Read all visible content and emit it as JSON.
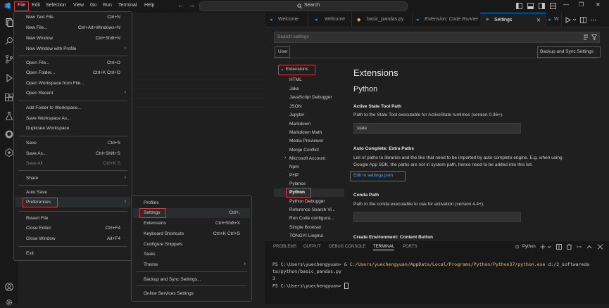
{
  "titlebar": {
    "menu": [
      "File",
      "Edit",
      "Selection",
      "View",
      "Go",
      "Run",
      "Terminal",
      "Help"
    ],
    "search_text": "Search",
    "nav_back": "←",
    "nav_forward": "→",
    "window_controls": [
      "—",
      "❐",
      "✕"
    ]
  },
  "file_menu": {
    "items": [
      {
        "label": "New Text File",
        "key": "Ctrl+N"
      },
      {
        "label": "New File...",
        "key": "Ctrl+Alt+Windows+N"
      },
      {
        "label": "New Window",
        "key": "Ctrl+Shift+N"
      },
      {
        "label": "New Window with Profile",
        "key": "›"
      },
      {
        "label": "Open File...",
        "key": "Ctrl+O"
      },
      {
        "label": "Open Folder...",
        "key": "Ctrl+K Ctrl+O"
      },
      {
        "label": "Open Workspace from File...",
        "key": ""
      },
      {
        "label": "Open Recent",
        "key": "›"
      },
      {
        "label": "Add Folder to Workspace...",
        "key": ""
      },
      {
        "label": "Save Workspace As...",
        "key": ""
      },
      {
        "label": "Duplicate Workspace",
        "key": ""
      },
      {
        "label": "Save",
        "key": "Ctrl+S"
      },
      {
        "label": "Save As...",
        "key": "Ctrl+Shift+S"
      },
      {
        "label": "Save All",
        "key": "Ctrl+K S"
      },
      {
        "label": "Share",
        "key": "›"
      },
      {
        "label": "Auto Save",
        "key": ""
      },
      {
        "label": "Preferences",
        "key": "›"
      },
      {
        "label": "Revert File",
        "key": ""
      },
      {
        "label": "Close Editor",
        "key": "Ctrl+F4"
      },
      {
        "label": "Close Window",
        "key": "Alt+F4"
      },
      {
        "label": "Exit",
        "key": ""
      }
    ]
  },
  "pref_menu": {
    "items": [
      {
        "label": "Profiles",
        "key": ""
      },
      {
        "label": "Settings",
        "key": "Ctrl+,"
      },
      {
        "label": "Extensions",
        "key": "Ctrl+Shift+X"
      },
      {
        "label": "Keyboard Shortcuts",
        "key": "Ctrl+K Ctrl+S"
      },
      {
        "label": "Configure Snippets",
        "key": ""
      },
      {
        "label": "Tasks",
        "key": ""
      },
      {
        "label": "Theme",
        "key": "›"
      },
      {
        "label": "Backup and Sync Settings...",
        "key": ""
      },
      {
        "label": "Online Services Settings",
        "key": ""
      }
    ]
  },
  "tabs": [
    "Welcome",
    "Welcome",
    "basic_pandas.py",
    "Extension: Code Runner",
    "Settings",
    "W"
  ],
  "settings": {
    "search_placeholder": "Search settings",
    "user_tab": "User",
    "sync_button": "Backup and Sync Settings",
    "toc_parent": "Extensions",
    "toc": [
      "HTML",
      "Jake",
      "JavaScript Debugger",
      "JSON",
      "Jupyter",
      "Markdown",
      "Markdown Math",
      "Media Previewer",
      "Merge Conflict",
      "Microsoft Account",
      "Npm",
      "PHP",
      "Pylance",
      "Python",
      "Python Debugger",
      "Reference Search Vi...",
      "Run Code configura...",
      "Simple Browser",
      "TONGYI Lingma"
    ],
    "heading": "Extensions",
    "subheading": "Python",
    "s1_title": "Active State Tool Path",
    "s1_desc": "Path to the State Tool executable for ActiveState runtimes (version 0.36+).",
    "s1_value": "state",
    "s2_title": "Auto Complete: Extra Paths",
    "s2_desc1": "List of paths to libraries and the like that need to be imported by auto complete engine. E.g. when using",
    "s2_desc2": "Google App SDK, the paths are not in system path, hence need to be added into this list.",
    "s2_link": "Edit in settings.json",
    "s3_title": "Conda Path",
    "s3_desc": "Path to the conda executable to use for activation (version 4.4+).",
    "s4_title": "Create Environment: Content Button"
  },
  "panel": {
    "tabs": [
      "PROBLEMS",
      "OUTPUT",
      "DEBUG CONSOLE",
      "TERMINAL",
      "PORTS"
    ],
    "terminal_name": "Python",
    "line1_prompt": "PS C:\\Users\\yuechengyuan> & ",
    "line1_path": "C:/Users/yuechengyuan/AppData/Local/Programs/Python/Python37/python.exe",
    "line1_arg": " d:/2_softwareda",
    "line2": "ta/python/basic_pandas.py",
    "line3": "3",
    "line4": "PS C:\\Users\\yuechengyuan> "
  },
  "colors": {
    "accent": "#0078d4",
    "highlight": "#e0343a",
    "link": "#4daafc"
  }
}
